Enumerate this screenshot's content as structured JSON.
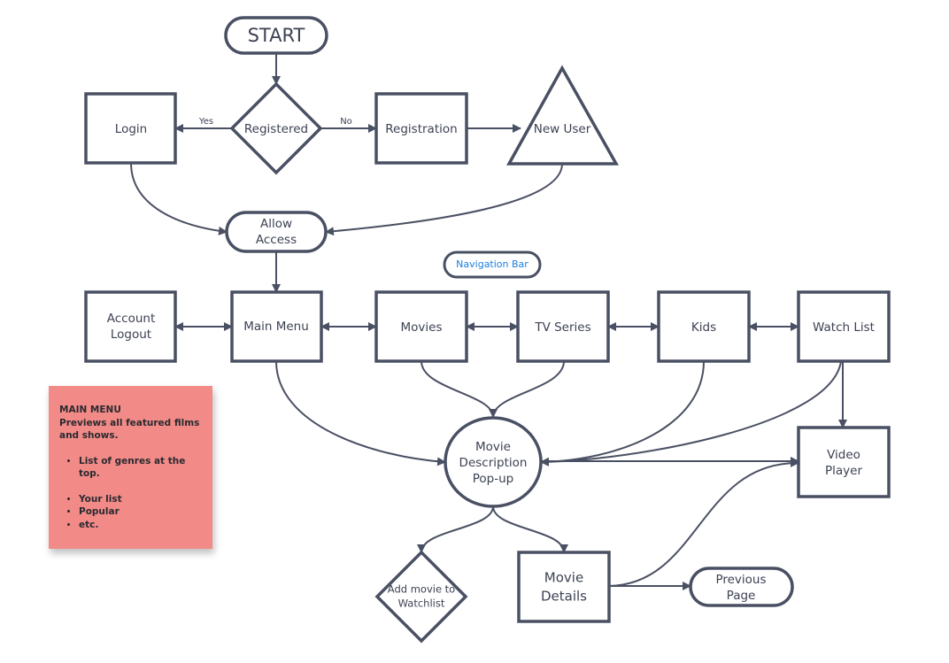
{
  "colors": {
    "stroke": "#4a5063",
    "note_bg": "#f28b87",
    "nav_text": "#1a7fe0"
  },
  "nodes": {
    "start": "START",
    "registered": "Registered",
    "login": "Login",
    "registration": "Registration",
    "new_user": "New User",
    "allow_access": [
      "Allow",
      "Access"
    ],
    "navigation_bar": "Navigation Bar",
    "account_logout": [
      "Account",
      "Logout"
    ],
    "main_menu": "Main Menu",
    "movies": "Movies",
    "tv_series": "TV Series",
    "kids": "Kids",
    "watch_list": "Watch List",
    "movie_description": [
      "Movie",
      "Description",
      "Pop-up"
    ],
    "video_player": [
      "Video",
      "Player"
    ],
    "add_to_watchlist": [
      "Add movie to",
      "Watchlist"
    ],
    "movie_details": [
      "Movie",
      "Details"
    ],
    "previous_page": [
      "Previous",
      "Page"
    ]
  },
  "edge_labels": {
    "yes": "Yes",
    "no": "No"
  },
  "note": {
    "title": "MAIN MENU",
    "subtitle": "Previews all featured films and shows.",
    "bullets_1": [
      "List of genres at the top."
    ],
    "bullets_2": [
      "Your list",
      "Popular",
      "etc."
    ]
  }
}
